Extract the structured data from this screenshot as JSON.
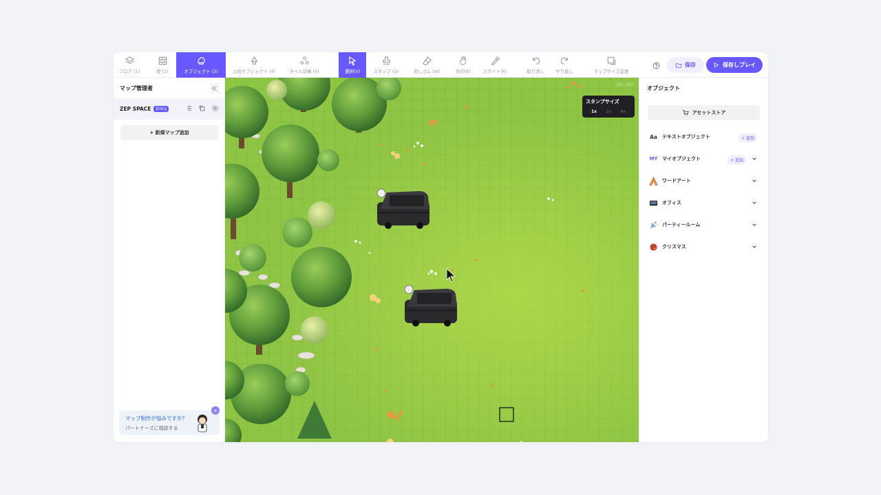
{
  "toolbar": {
    "tools": [
      {
        "label": "フロア (1)",
        "icon": "layers-icon"
      },
      {
        "label": "壁 (2)",
        "icon": "wall-icon"
      },
      {
        "label": "オブジェクト (3)",
        "icon": "object-icon",
        "active": true
      },
      {
        "label": "上段オブジェクト (4)",
        "icon": "upper-object-icon"
      },
      {
        "label": "タイル効果 (5)",
        "icon": "tile-effect-icon"
      },
      {
        "label": "選択(V)",
        "icon": "cursor-icon",
        "active": true
      },
      {
        "label": "スタンプ (G)",
        "icon": "stamp-icon"
      },
      {
        "label": "消しゴム (W)",
        "icon": "eraser-icon"
      },
      {
        "label": "矢印(E)",
        "icon": "hand-icon"
      },
      {
        "label": "スポイト(R)",
        "icon": "eyedropper-icon"
      },
      {
        "label": "取り消し",
        "icon": "undo-icon"
      },
      {
        "label": "やり直し",
        "icon": "redo-icon"
      },
      {
        "label": "マップサイズ変更",
        "icon": "resize-icon"
      }
    ],
    "save_label": "保存",
    "play_label": "保存しプレイ",
    "accent": "#6758ff"
  },
  "left_panel": {
    "title": "マップ管理者",
    "space_name": "ZEP SPACE",
    "space_badge": "Entry",
    "add_map_label": "+ 新規マップ追加",
    "help_title": "マップ制作が悩みですか？",
    "help_sub": "パートナーズに相談する"
  },
  "canvas": {
    "coords": "(20, 24)",
    "stamp_popup": {
      "title": "スタンプサイズ",
      "sizes": [
        "1x",
        "2x",
        "4x"
      ],
      "selected": "1x"
    }
  },
  "right_panel": {
    "title": "オブジェクト",
    "asset_store_label": "アセットストア",
    "categories": [
      {
        "label": "テキストオブジェクト",
        "icon": "text-aa-icon",
        "action": "+ 追加"
      },
      {
        "label": "マイオブジェクト",
        "icon": "my-icon",
        "action": "+ 追加"
      },
      {
        "label": "ワードアート",
        "icon": "wordart-icon"
      },
      {
        "label": "オフィス",
        "icon": "office-icon"
      },
      {
        "label": "パーティールーム",
        "icon": "party-icon"
      },
      {
        "label": "クリスマス",
        "icon": "christmas-icon"
      }
    ]
  }
}
